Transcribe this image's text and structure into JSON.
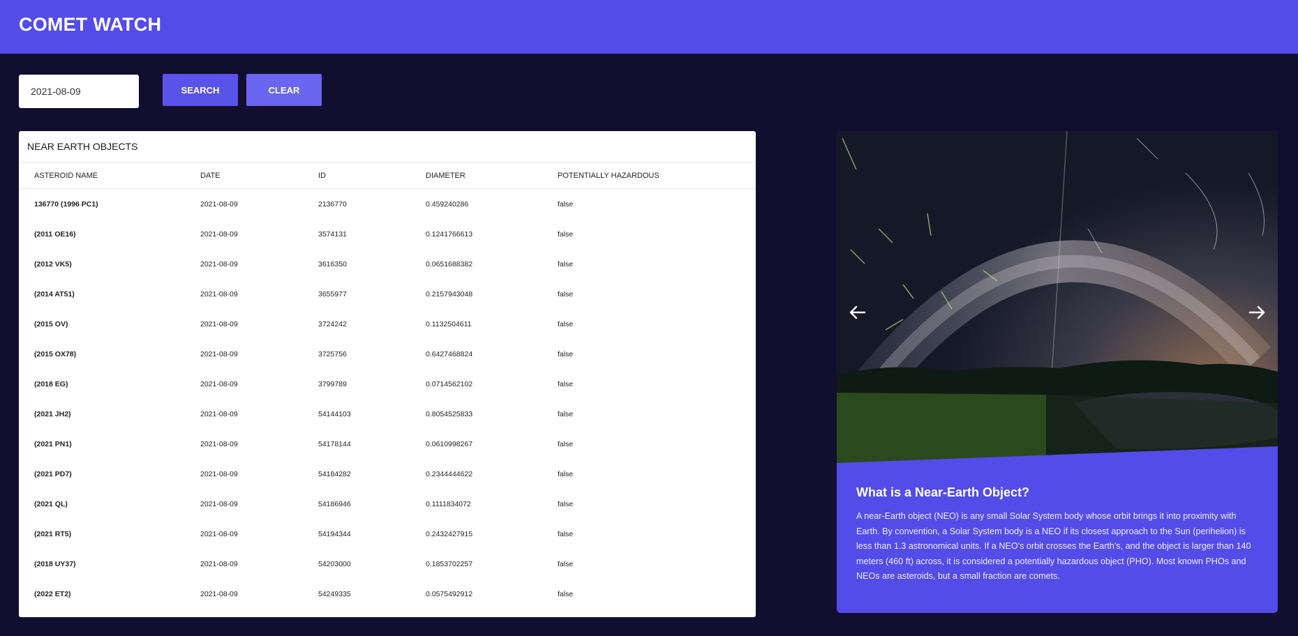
{
  "header": {
    "title": "COMET WATCH"
  },
  "search": {
    "date_value": "2021-08-09",
    "search_label": "SEARCH",
    "clear_label": "CLEAR"
  },
  "table": {
    "title": "NEAR EARTH OBJECTS",
    "columns": [
      "ASTEROID NAME",
      "DATE",
      "ID",
      "DIAMETER",
      "POTENTIALLY HAZARDOUS"
    ],
    "rows": [
      [
        "136770 (1996 PC1)",
        "2021-08-09",
        "2136770",
        "0.459240286",
        "false"
      ],
      [
        "(2011 OE16)",
        "2021-08-09",
        "3574131",
        "0.1241766613",
        "false"
      ],
      [
        "(2012 VK5)",
        "2021-08-09",
        "3616350",
        "0.0651688382",
        "false"
      ],
      [
        "(2014 AT51)",
        "2021-08-09",
        "3655977",
        "0.2157943048",
        "false"
      ],
      [
        "(2015 OV)",
        "2021-08-09",
        "3724242",
        "0.1132504611",
        "false"
      ],
      [
        "(2015 OX78)",
        "2021-08-09",
        "3725756",
        "0.6427468824",
        "false"
      ],
      [
        "(2018 EG)",
        "2021-08-09",
        "3799789",
        "0.0714562102",
        "false"
      ],
      [
        "(2021 JH2)",
        "2021-08-09",
        "54144103",
        "0.8054525833",
        "false"
      ],
      [
        "(2021 PN1)",
        "2021-08-09",
        "54178144",
        "0.0610998267",
        "false"
      ],
      [
        "(2021 PD7)",
        "2021-08-09",
        "54184282",
        "0.2344444622",
        "false"
      ],
      [
        "(2021 QL)",
        "2021-08-09",
        "54186946",
        "0.1111834072",
        "false"
      ],
      [
        "(2021 RT5)",
        "2021-08-09",
        "54194344",
        "0.2432427915",
        "false"
      ],
      [
        "(2018 UY37)",
        "2021-08-09",
        "54203000",
        "0.1853702257",
        "false"
      ],
      [
        "(2022 ET2)",
        "2021-08-09",
        "54249335",
        "0.0575492912",
        "false"
      ]
    ]
  },
  "info_card": {
    "heading": "What is a Near-Earth Object?",
    "text": "A near-Earth object (NEO) is any small Solar System body whose orbit brings it into proximity with Earth. By convention, a Solar System body is a NEO if its closest approach to the Sun (perihelion) is less than 1.3 astronomical units. If a NEO's orbit crosses the Earth's, and the object is larger than 140 meters (460 ft) across, it is considered a potentially hazardous object (PHO). Most known PHOs and NEOs are asteroids, but a small fraction are comets.",
    "prev_icon": "arrow-left-icon",
    "next_icon": "arrow-right-icon"
  },
  "colors": {
    "header_bg": "#534ce9",
    "page_bg": "#120e30",
    "card_bg": "#534ce9"
  }
}
